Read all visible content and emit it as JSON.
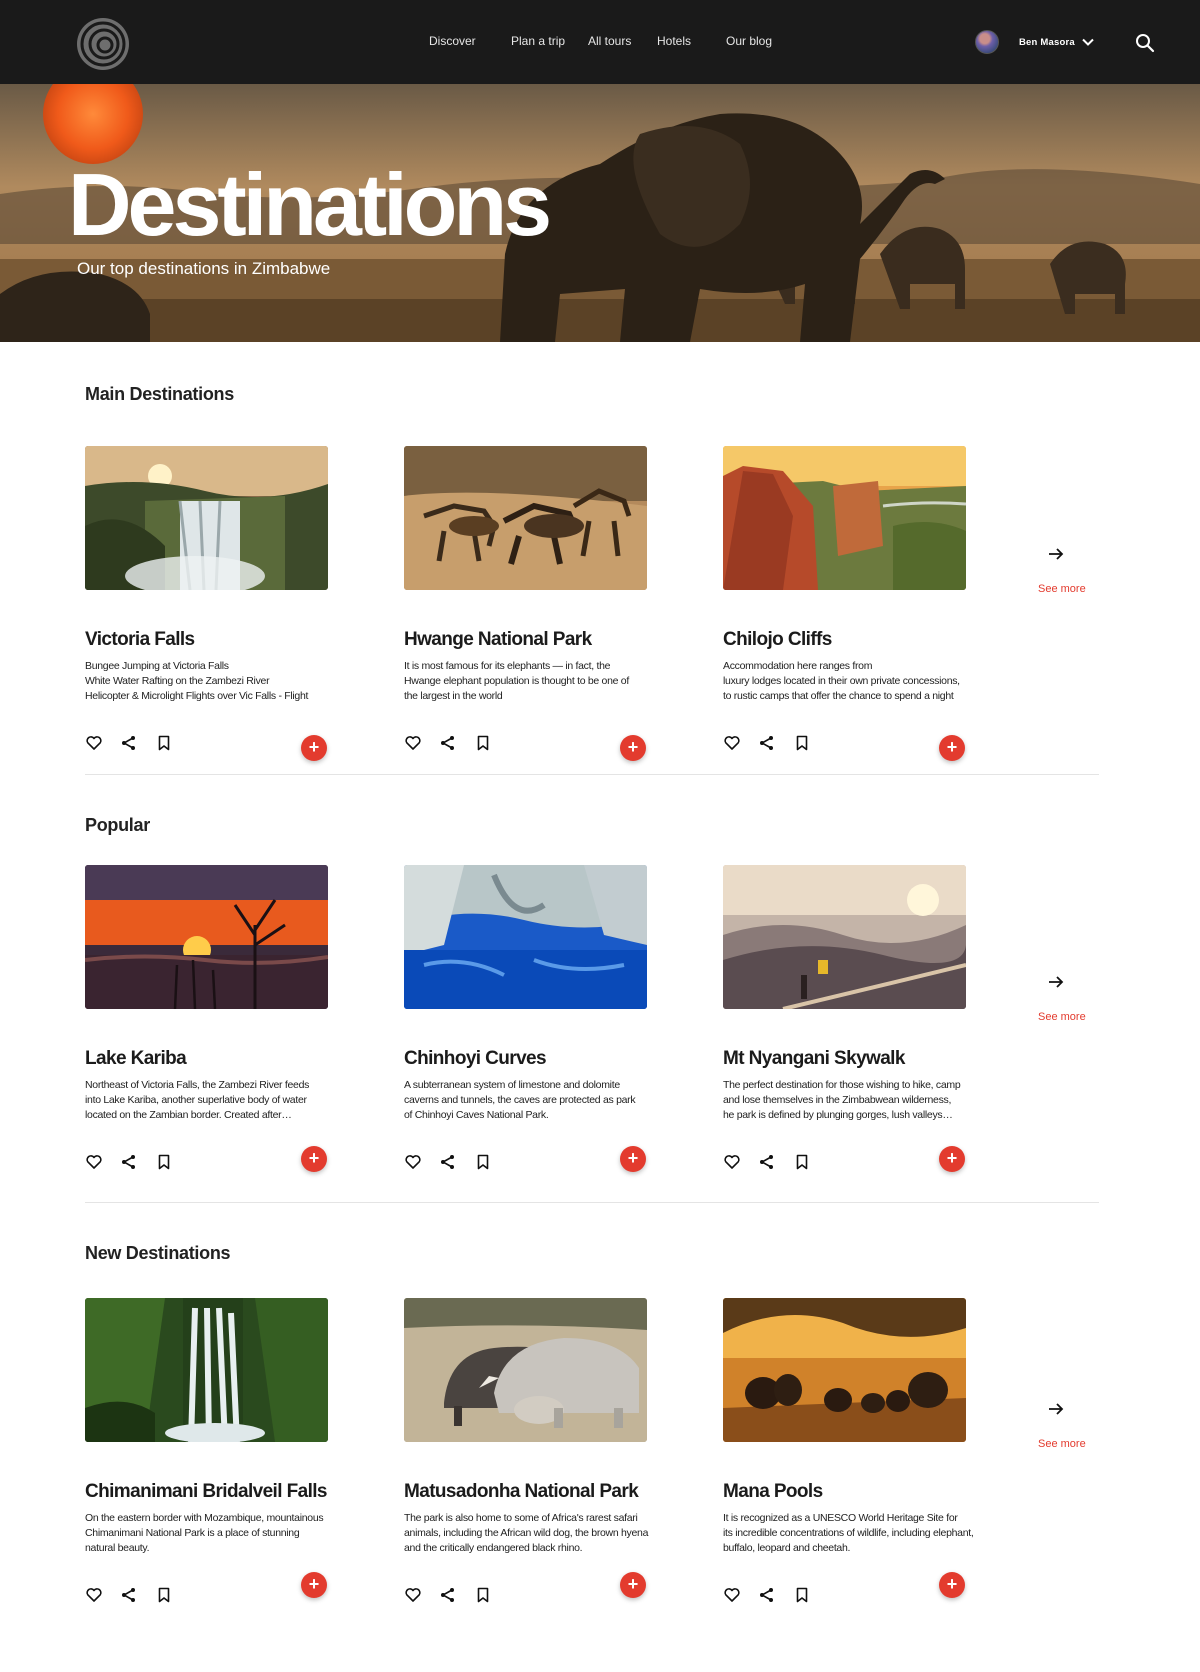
{
  "nav": {
    "links": [
      "Discover",
      "Plan a trip",
      "All tours",
      "Hotels",
      "Our blog"
    ],
    "user_name": "Ben Masora"
  },
  "hero": {
    "title": "Destinations",
    "subtitle": "Our top destinations in Zimbabwe"
  },
  "sections": [
    {
      "title": "Main Destinations",
      "see_more": "See more",
      "cards": [
        {
          "title": "Victoria Falls",
          "desc": "Bungee Jumping at Victoria Falls\nWhite Water Rafting on the Zambezi River\nHelicopter & Microlight Flights over Vic Falls - Flight"
        },
        {
          "title": "Hwange National Park",
          "desc": "It is most famous for its elephants — in fact, the\nHwange elephant population is thought to be one of\nthe largest in the world"
        },
        {
          "title": "Chilojo Cliffs",
          "desc": "Accommodation here ranges from\nluxury lodges located in their own private concessions,\nto rustic camps that offer the chance to spend a night"
        }
      ]
    },
    {
      "title": "Popular",
      "see_more": "See more",
      "cards": [
        {
          "title": "Lake Kariba",
          "desc": "Northeast of Victoria Falls, the Zambezi River feeds\ninto Lake Kariba, another superlative body of water\nlocated on the Zambian border. Created after…"
        },
        {
          "title": "Chinhoyi Curves",
          "desc": "A subterranean system of limestone and dolomite\ncaverns and tunnels, the caves are protected as park\nof Chinhoyi Caves National Park."
        },
        {
          "title": "Mt Nyangani Skywalk",
          "desc": "The perfect destination for those wishing to hike, camp\nand lose themselves in the Zimbabwean wilderness,\nhe park is defined by plunging gorges, lush valleys…"
        }
      ]
    },
    {
      "title": "New Destinations",
      "see_more": "See more",
      "cards": [
        {
          "title": "Chimanimani Bridalveil Falls",
          "desc": "On the eastern border with Mozambique, mountainous\nChimanimani National Park is a place of stunning\nnatural beauty."
        },
        {
          "title": "Matusadonha National Park",
          "desc": "The park is also home to some of Africa's rarest safari\nanimals, including the African wild dog, the brown hyena\nand the critically endangered black rhino."
        },
        {
          "title": "Mana Pools",
          "desc": "It is recognized as a UNESCO World Heritage Site for\nits incredible concentrations of wildlife, including elephant,\nbuffalo, leopard and cheetah."
        }
      ]
    }
  ],
  "colors": {
    "accent": "#e33b2e",
    "nav_bg": "#1a1a1a"
  },
  "icons": {
    "card_actions": [
      "heart-icon",
      "share-icon",
      "bookmark-icon"
    ],
    "add": "plus-icon",
    "see_more": "arrow-right-icon"
  }
}
